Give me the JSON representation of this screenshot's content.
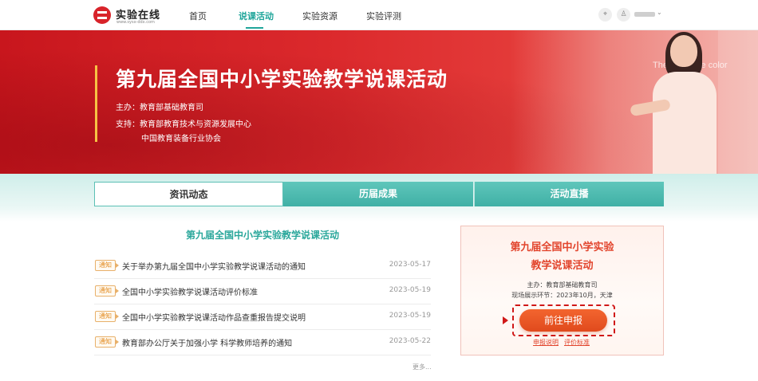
{
  "header": {
    "logo_text": "实验在线",
    "logo_sub": "www.sysx-ddx.com",
    "nav": [
      "首页",
      "说课活动",
      "实验资源",
      "实验评测"
    ],
    "active_nav": "说课活动",
    "icons": [
      "location-icon",
      "user-icon",
      "chevron-down-icon"
    ]
  },
  "banner": {
    "title": "第九届全国中小学实验教学说课活动",
    "host": "主办：教育部基础教育司",
    "support": "支持：教育部教育技术与资源发展中心",
    "support2": "中国教育装备行业协会",
    "board_text": "The    s change color"
  },
  "tabs": [
    "资讯动态",
    "历届成果",
    "活动直播"
  ],
  "active_tab": "资讯动态",
  "news": {
    "title": "第九届全国中小学实验教学说课活动",
    "items": [
      {
        "tag": "通知",
        "text": "关于举办第九届全国中小学实验教学说课活动的通知",
        "date": "2023-05-17"
      },
      {
        "tag": "通知",
        "text": "全国中小学实验教学说课活动评价标准",
        "date": "2023-05-19"
      },
      {
        "tag": "通知",
        "text": "全国中小学实验教学说课活动作品查重报告提交说明",
        "date": "2023-05-19"
      },
      {
        "tag": "通知",
        "text": "教育部办公厅关于加强小学 科学教师培养的通知",
        "date": "2023-05-22"
      }
    ],
    "more": "更多..."
  },
  "card": {
    "title_line1": "第九届全国中小学实验",
    "title_line2": "教学说课活动",
    "host": "主办：教育部基础教育司",
    "venue": "现场展示环节：2023年10月，天津",
    "button": "前往申报",
    "link1": "申报说明",
    "link2": "评价标准"
  },
  "colors": {
    "brand_red": "#d8232a",
    "teal": "#1fa59a",
    "banner_accent": "#f6c244",
    "cta_orange": "#e04a1d"
  }
}
